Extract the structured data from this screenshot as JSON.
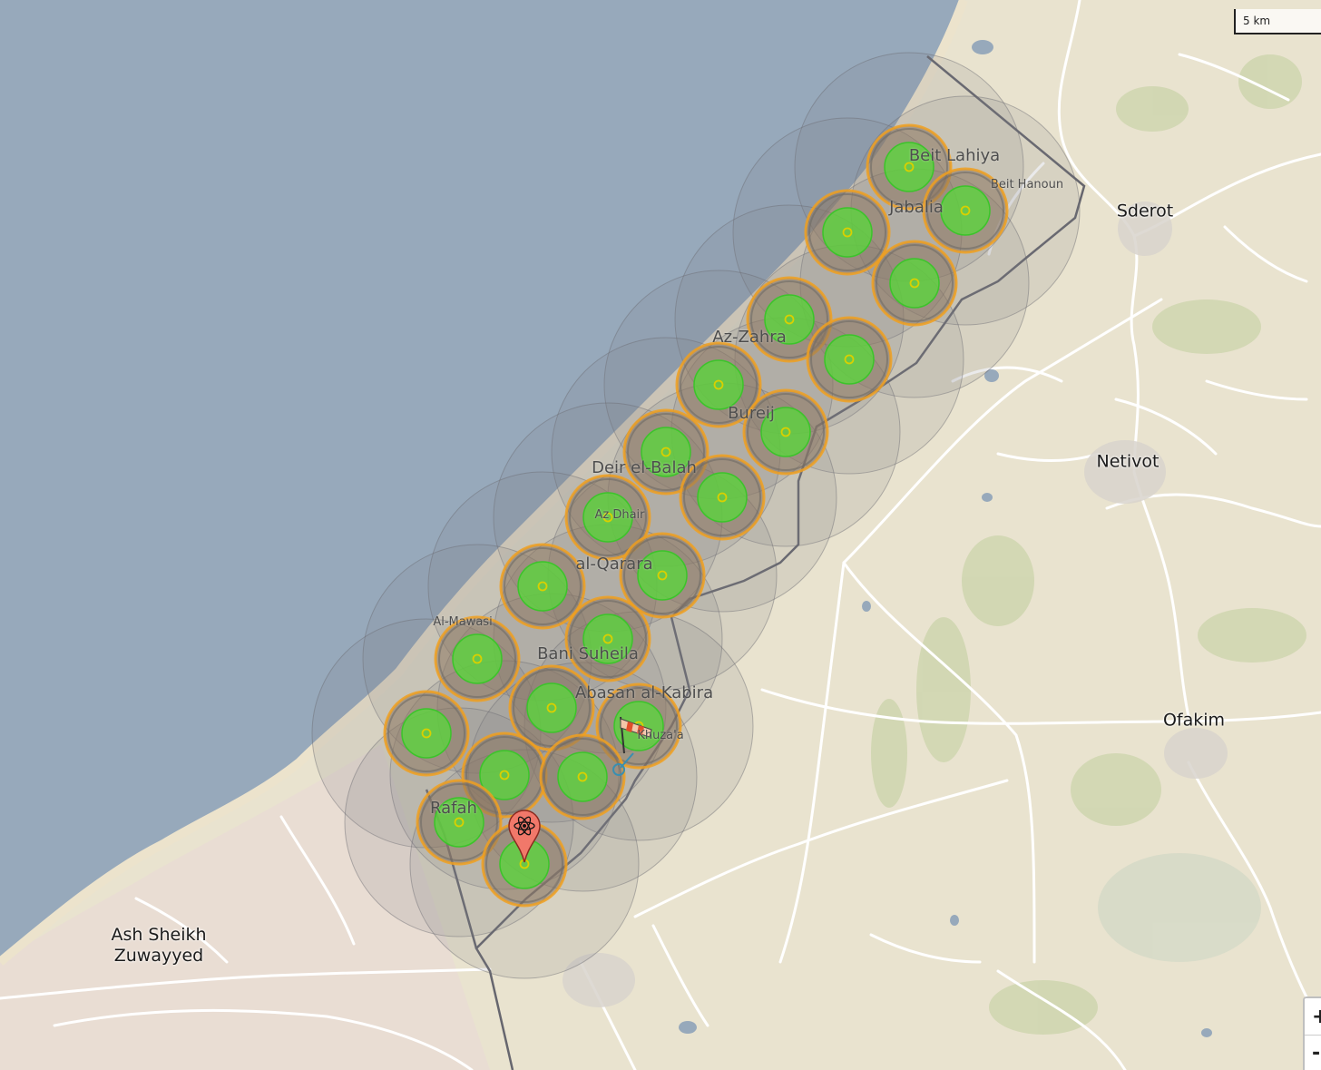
{
  "map": {
    "scale_label": "5 km",
    "zoom_in_label": "+",
    "zoom_out_label": "-",
    "colors": {
      "sea": "#97a9bb",
      "land": "#e9e3cf",
      "beach": "#e6dfcf",
      "coverage_outer": "#7d7d80",
      "coverage_ring": "#f0a020",
      "coverage_inner": "#58d83a",
      "border": "#66666e"
    },
    "places": [
      {
        "name": "Beit Lahiya",
        "kind": "town"
      },
      {
        "name": "Beit Hanoun",
        "kind": "small"
      },
      {
        "name": "Jabalia",
        "kind": "town"
      },
      {
        "name": "Sderot",
        "kind": "city"
      },
      {
        "name": "Az-Zahra",
        "kind": "town"
      },
      {
        "name": "Bureij",
        "kind": "town"
      },
      {
        "name": "Netivot",
        "kind": "city"
      },
      {
        "name": "Deir el-Balah",
        "kind": "town"
      },
      {
        "name": "Az Dhair",
        "kind": "small"
      },
      {
        "name": "al-Qarara",
        "kind": "town"
      },
      {
        "name": "Al-Mawasi",
        "kind": "small"
      },
      {
        "name": "Bani Suheila",
        "kind": "town"
      },
      {
        "name": "Abasan al-Kabira",
        "kind": "town"
      },
      {
        "name": "Khuza'a",
        "kind": "small"
      },
      {
        "name": "Ofakim",
        "kind": "city"
      },
      {
        "name": "Rafah",
        "kind": "town"
      },
      {
        "name": "Ash Sheikh\nZuwayyed",
        "kind": "city"
      }
    ],
    "markers": [
      {
        "name": "atom-marker",
        "icon": "atom-icon"
      },
      {
        "name": "windsock-marker",
        "icon": "windsock-icon"
      }
    ]
  }
}
